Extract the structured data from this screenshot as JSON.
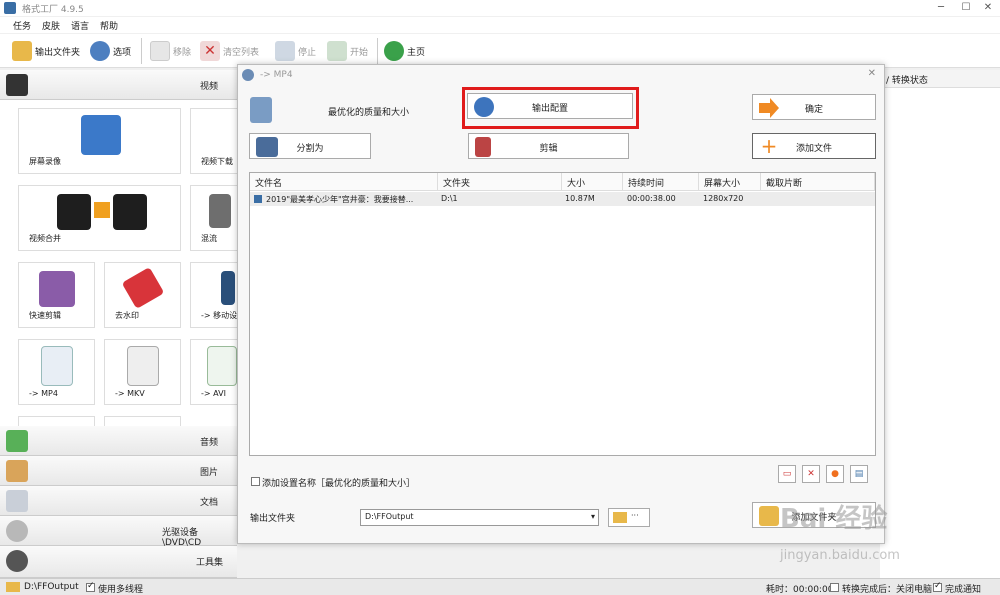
{
  "window": {
    "title": "格式工厂 4.9.5",
    "min": "─",
    "max": "☐",
    "close": "✕"
  },
  "menu": [
    "任务",
    "皮肤",
    "语言",
    "帮助"
  ],
  "toolbar": {
    "output_folder": "输出文件夹",
    "options": "选项",
    "remove": "移除",
    "clear_list": "清空列表",
    "stop": "停止",
    "start": "开始",
    "home": "主页"
  },
  "left": {
    "video_header": "视频",
    "tiles": {
      "screen_record": "屏幕录像",
      "video_download": "视频下载",
      "video_merge": "视频合并",
      "mix": "混流",
      "quick_cut": "快速剪辑",
      "watermark_remove": "去水印",
      "to_mobile": "-> 移动设",
      "to_mp4": "-> MP4",
      "to_mkv": "-> MKV",
      "to_avi": "-> AVI"
    },
    "categories": [
      "音频",
      "图片",
      "文档",
      "光驱设备\\DVD\\CD",
      "工具集"
    ]
  },
  "right": {
    "header": "/ 转换状态"
  },
  "dialog": {
    "title": "-> MP4",
    "close": "✕",
    "quality": "最优化的质量和大小",
    "output_config": "输出配置",
    "ok": "确定",
    "split": "分割为",
    "edit": "剪辑",
    "add_file": "添加文件",
    "columns": [
      "文件名",
      "文件夹",
      "大小",
      "持续时间",
      "屏幕大小",
      "截取片断"
    ],
    "rows": [
      {
        "name": "2019\"最美孝心少年\"宫井豪：我要接替...",
        "folder": "D:\\1",
        "size": "10.87M",
        "duration": "00:00:38.00",
        "screen": "1280x720",
        "clip": ""
      }
    ],
    "add_setting_name": "添加设置名称［最优化的质量和大小］",
    "output_folder_label": "输出文件夹",
    "output_folder_value": "D:\\FFOutput",
    "browse_dots": "···",
    "add_folder": "添加文件夹"
  },
  "status": {
    "path": "D:\\FFOutput",
    "multithread": "使用多线程",
    "elapsed": "耗时：00:00:00",
    "after_done": "转换完成后：关闭电脑",
    "notify": "完成通知"
  },
  "watermark": {
    "main": "Bai 经验",
    "url": "jingyan.baidu.com"
  },
  "colors": {
    "highlight": "#e01b1b",
    "accent_blue": "#2f6db5"
  }
}
